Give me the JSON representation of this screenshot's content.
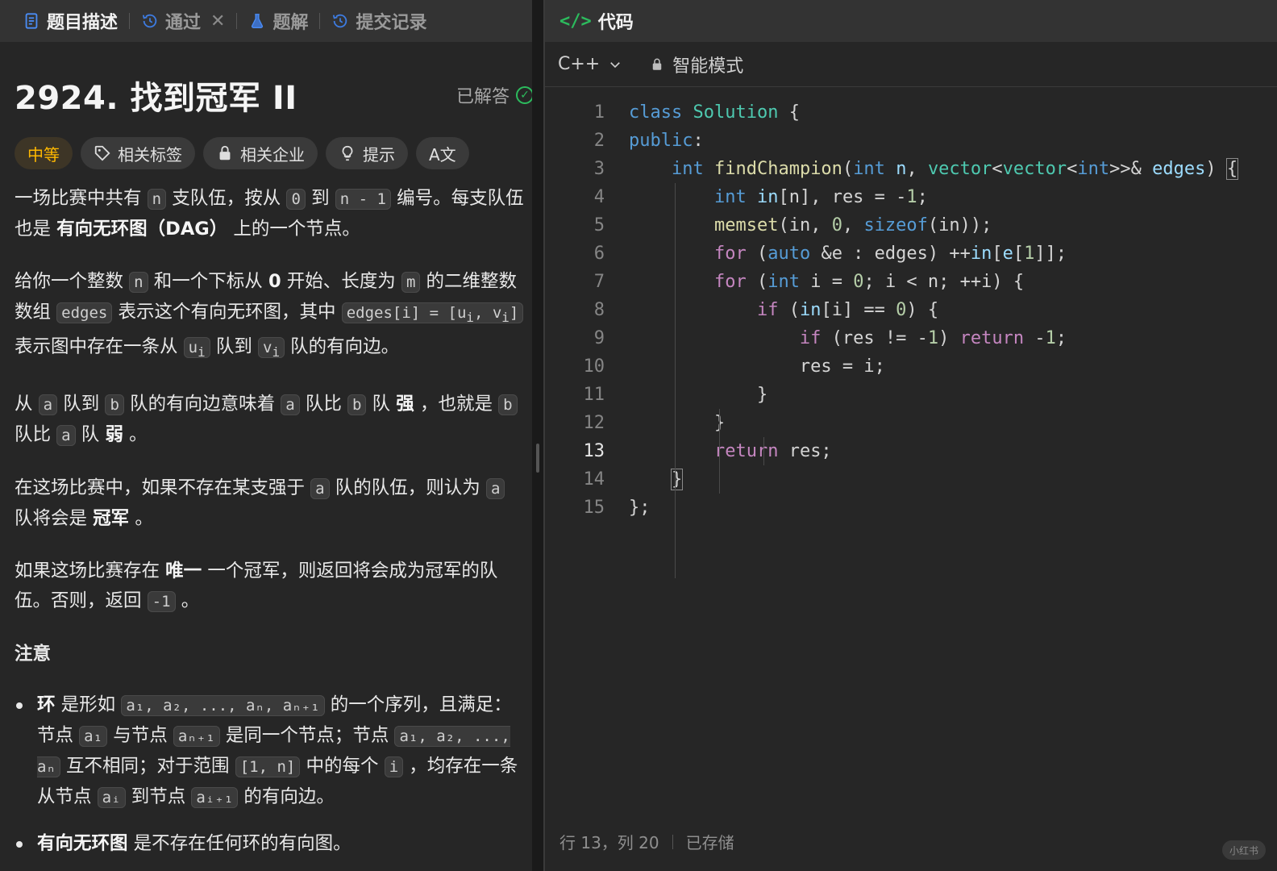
{
  "left_tabs": [
    {
      "label": "题目描述",
      "icon": "document-icon",
      "active": true
    },
    {
      "label": "通过",
      "icon": "history-icon",
      "active": false
    },
    {
      "label": "题解",
      "icon": "flask-icon",
      "active": false
    },
    {
      "label": "提交记录",
      "icon": "history-icon",
      "active": false
    }
  ],
  "close_glyph": "✕",
  "problem": {
    "title": "2924. 找到冠军 II",
    "status": "已解答",
    "chips": {
      "difficulty": "中等",
      "tags": "相关标签",
      "companies": "相关企业",
      "hint": "提示",
      "translate": "A文"
    },
    "p1": {
      "t1": "一场比赛中共有",
      "c1": "n",
      "t2": "支队伍，按从",
      "c2": "0",
      "t3": "到",
      "c3": "n - 1",
      "t4": "编号。每支队伍也是",
      "b1": "有向无环图（DAG）",
      "t5": "上的一个节点。"
    },
    "p2": {
      "t1": "给你一个整数",
      "c1": "n",
      "t2": "和一个下标从",
      "b1": "0",
      "t3": "开始、长度为",
      "c2": "m",
      "t4": "的二维整数数组",
      "c3": "edges",
      "t5": "表示这个有向无环图，其中",
      "c4": "edges[i] = [u",
      "c4s": "i",
      "c4b": ", v",
      "c4s2": "i",
      "c4e": "]",
      "t6": "表示图中存在一条从",
      "c5": "u",
      "c5s": "i",
      "t7": "队到",
      "c6": "v",
      "c6s": "i",
      "t8": "队的有向边。"
    },
    "p3": {
      "t1": "从",
      "c1": "a",
      "t2": "队到",
      "c2": "b",
      "t3": "队的有向边意味着",
      "c3": "a",
      "t4": "队比",
      "c4": "b",
      "t5": "队",
      "b1": "强",
      "t6": "，也就是",
      "c5": "b",
      "t7": "队比",
      "c6": "a",
      "t8": "队",
      "b2": "弱",
      "t9": "。"
    },
    "p4": {
      "t1": "在这场比赛中，如果不存在某支强于",
      "c1": "a",
      "t2": "队的队伍，则认为",
      "c2": "a",
      "t3": "队将会是",
      "b1": "冠军",
      "t4": "。"
    },
    "p5": {
      "t1": "如果这场比赛存在",
      "b1": "唯一",
      "t2": "一个冠军，则返回将会成为冠军的队伍。否则，返回",
      "c1": "-1",
      "t3": "。"
    },
    "note_title": "注意",
    "li1": {
      "b1": "环",
      "t1": "是形如",
      "c1": "a₁, a₂, ..., aₙ, aₙ₊₁",
      "t2": "的一个序列，且满足：节点",
      "c2": "a₁",
      "t3": "与节点",
      "c3": "aₙ₊₁",
      "t4": "是同一个节点；节点",
      "c4": "a₁, a₂, ..., aₙ",
      "t5": "互不相同；对于范围",
      "c5": "[1, n]",
      "t6": "中的每个",
      "c6": "i",
      "t7": "，均存在一条从节点",
      "c7": "aᵢ",
      "t8": "到节点",
      "c8": "aᵢ₊₁",
      "t9": "的有向边。"
    },
    "li2": {
      "b1": "有向无环图",
      "t1": "是不存在任何环的有向图。"
    }
  },
  "editor": {
    "header": "代码",
    "language": "C++",
    "mode": "智能模式",
    "current_line": 13,
    "status_position": "行 13，列 20",
    "status_saved": "已存储",
    "watermark": "小红书"
  }
}
